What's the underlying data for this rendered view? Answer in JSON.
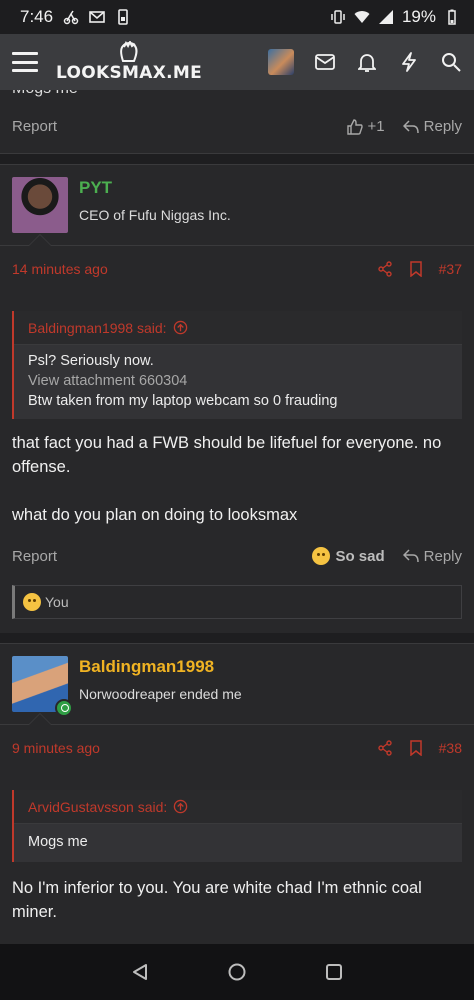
{
  "status_bar": {
    "time": "7:46",
    "battery": "19%"
  },
  "header": {
    "site_name": "LOOKSMAX.ME"
  },
  "prev_post": {
    "cut_text": "Mogs me",
    "report_label": "Report",
    "like_count": "+1",
    "reply_label": "Reply"
  },
  "posts": [
    {
      "username": "PYT",
      "user_title": "CEO of Fufu Niggas Inc.",
      "time": "14 minutes ago",
      "number": "#37",
      "quote": {
        "author": "Baldingman1998 said:",
        "lines": [
          "Psl? Seriously now.",
          "View attachment 660304",
          "Btw taken from my laptop webcam so 0 frauding"
        ]
      },
      "message": [
        "that fact you had a FWB should be lifefuel for everyone. no offense.",
        "what do you plan on doing to looksmax"
      ],
      "report_label": "Report",
      "reaction_label": "So sad",
      "reply_label": "Reply",
      "reacted_by": "You"
    },
    {
      "username": "Baldingman1998",
      "user_title": "Norwoodreaper ended me",
      "time": "9 minutes ago",
      "number": "#38",
      "quote": {
        "author": "ArvidGustavsson said:",
        "lines": [
          "Mogs me"
        ]
      },
      "message": [
        "No I'm inferior to you. You are white chad I'm ethnic coal miner."
      ]
    }
  ],
  "colors": {
    "accent": "#c0392b",
    "username_green": "#4caf50",
    "username_gold": "#f0b323",
    "header_bg": "#3b3c3f"
  }
}
